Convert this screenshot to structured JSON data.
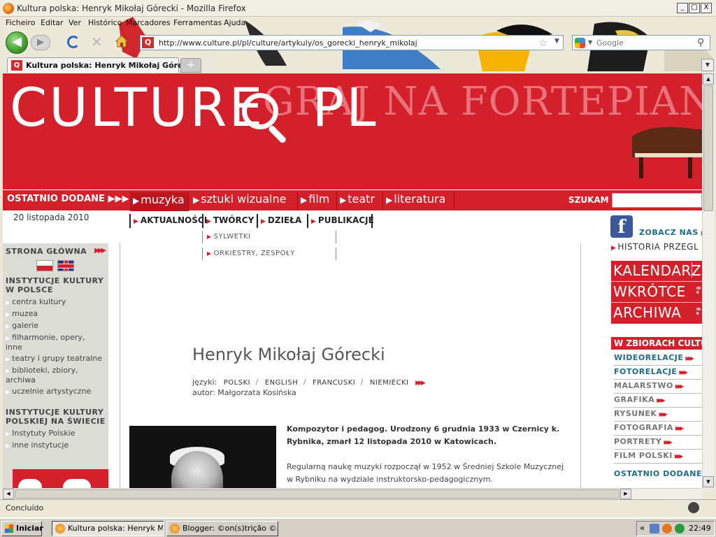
{
  "window": {
    "title": "Kultura polska: Henryk Mikołaj Górecki - Mozilla Firefox",
    "minimize": "_",
    "maximize": "□",
    "close": "X"
  },
  "menu": [
    "Ficheiro",
    "Editar",
    "Ver",
    "Histórico",
    "Marcadores",
    "Ferramentas",
    "Ajuda"
  ],
  "nav": {
    "url": "http://www.culture.pl/pl/culture/artykuly/os_gorecki_henryk_mikolaj",
    "search_placeholder": "Google",
    "site_icon": "Q"
  },
  "tabs": {
    "active_title": "Kultura polska: Henryk Mikołaj Górec...",
    "new_tab": "+"
  },
  "banner": {
    "logo": "CULTURE",
    "logo_suffix": "PL",
    "background_text": "GRAJ NA FORTEPIANIE CH"
  },
  "rednav": {
    "latest": "OSTATNIO DODANE ▶▶▶",
    "categories": [
      "muzyka",
      "sztuki wizualne",
      "film",
      "teatr",
      "literatura"
    ],
    "search_label": "SZUKAM"
  },
  "date": "20 listopada 2010",
  "subnav": {
    "items": [
      "AKTUALNOŚCI",
      "TWÓRCY",
      "DZIEŁA",
      "PUBLIKACJE"
    ],
    "sub": [
      "SYLWETKI",
      "ORKIESTRY, ZESPOŁY"
    ]
  },
  "left": {
    "home": "STRONA GŁÓWNA",
    "arrows": "▶▶▶",
    "section1": "INSTYTUCJE KULTURY W POLSCE",
    "items1": [
      "centra kultury",
      "muzea",
      "galerie",
      "filharmonie, opery, inne",
      "teatry i grupy teatralne",
      "biblioteki, zbiory, archiwa",
      "uczelnie artystyczne"
    ],
    "section2": "INSTYTUCJE KULTURY POLSKIEJ NA ŚWIECIE",
    "items2": [
      "Instytuty Polskie",
      "inne instytucje"
    ]
  },
  "article": {
    "title": "Henryk Mikołaj Górecki",
    "languages_label": "języki:",
    "languages": [
      "POLSKI",
      "ENGLISH",
      "FRANCUSKI",
      "NIEMIECKI"
    ],
    "arrows": "▶▶▶",
    "author": "autor: Małgorzata Kosińska",
    "lead": "Kompozytor i pedagog. Urodzony 6 grudnia 1933 w Czernicy k. Rybnika, zmarł 12 listopada 2010 w Katowicach.",
    "body": "Regularną naukę muzyki rozpoczął w 1952 w Średniej Szkole Muzycznej w Rybniku na wydziale instruktorsko-pedagogicznym."
  },
  "right": {
    "facebook_text": "ZOBACZ NAS",
    "history": "HISTORIA PRZEGL",
    "kalendarz": "KALENDARZ",
    "wkrotce": "WKRÓTCE",
    "archiwa": "ARCHIWA",
    "mini1": "IN",
    "mini2": "K",
    "zbiorach": "W ZBIORACH CULTU",
    "collections": [
      {
        "label": "WIDEORELACJE",
        "color": "#1e6b8a"
      },
      {
        "label": "FOTORELACJE",
        "color": "#1e6b8a"
      },
      {
        "label": "MALARSTWO",
        "color": "#777777"
      },
      {
        "label": "GRAFIKA",
        "color": "#777777"
      },
      {
        "label": "RYSUNEK",
        "color": "#777777"
      },
      {
        "label": "FOTOGRAFIA",
        "color": "#777777"
      },
      {
        "label": "PORTRETY",
        "color": "#777777"
      },
      {
        "label": "FILM POLSKI",
        "color": "#777777"
      }
    ],
    "ostatnio": "OSTATNIO DODANE"
  },
  "status": "Concluído",
  "taskbar": {
    "start": "Iniciar",
    "apps": [
      "Kultura polska: Henryk M...",
      "Blogger: ©on(s)trição ©..."
    ],
    "clock": "22:49"
  },
  "colors": {
    "brand_red": "#d3202a",
    "link_blue": "#1e6b8a"
  }
}
